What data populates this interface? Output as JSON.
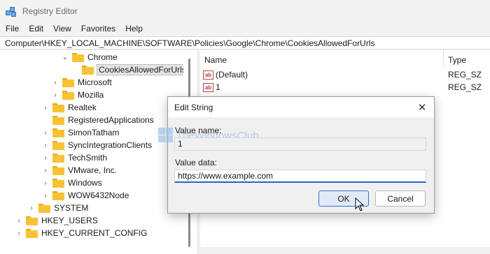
{
  "window": {
    "title": "Registry Editor"
  },
  "menu": [
    "File",
    "Edit",
    "View",
    "Favorites",
    "Help"
  ],
  "address": "Computer\\HKEY_LOCAL_MACHINE\\SOFTWARE\\Policies\\Google\\Chrome\\CookiesAllowedForUrls",
  "tree": [
    {
      "label": "Chrome",
      "expanded": true
    },
    {
      "label": "CookiesAllowedForUrls",
      "selected": true
    },
    {
      "label": "Microsoft"
    },
    {
      "label": "Mozilla"
    },
    {
      "label": "Realtek"
    },
    {
      "label": "RegisteredApplications"
    },
    {
      "label": "SimonTatham"
    },
    {
      "label": "SyncIntegrationClients"
    },
    {
      "label": "TechSmith"
    },
    {
      "label": "VMware, Inc."
    },
    {
      "label": "Windows"
    },
    {
      "label": "WOW6432Node"
    },
    {
      "label": "SYSTEM"
    },
    {
      "label": "HKEY_USERS"
    },
    {
      "label": "HKEY_CURRENT_CONFIG"
    }
  ],
  "list": {
    "columns": {
      "name": "Name",
      "type": "Type"
    },
    "rows": [
      {
        "icon": "string-value-icon",
        "icon_text": "ab",
        "name": "(Default)",
        "type": "REG_SZ"
      },
      {
        "icon": "string-value-icon",
        "icon_text": "ab",
        "name": "1",
        "type": "REG_SZ"
      }
    ]
  },
  "dialog": {
    "title": "Edit String",
    "close_glyph": "✕",
    "watermark": "TheWindowsClub",
    "value_name_label": "Value name:",
    "value_name": "1",
    "value_data_label": "Value data:",
    "value_data": "https://www.example.com",
    "ok_label": "OK",
    "cancel_label": "Cancel"
  },
  "icons": {
    "chevron_down": "⌄",
    "chevron_right": "›"
  }
}
